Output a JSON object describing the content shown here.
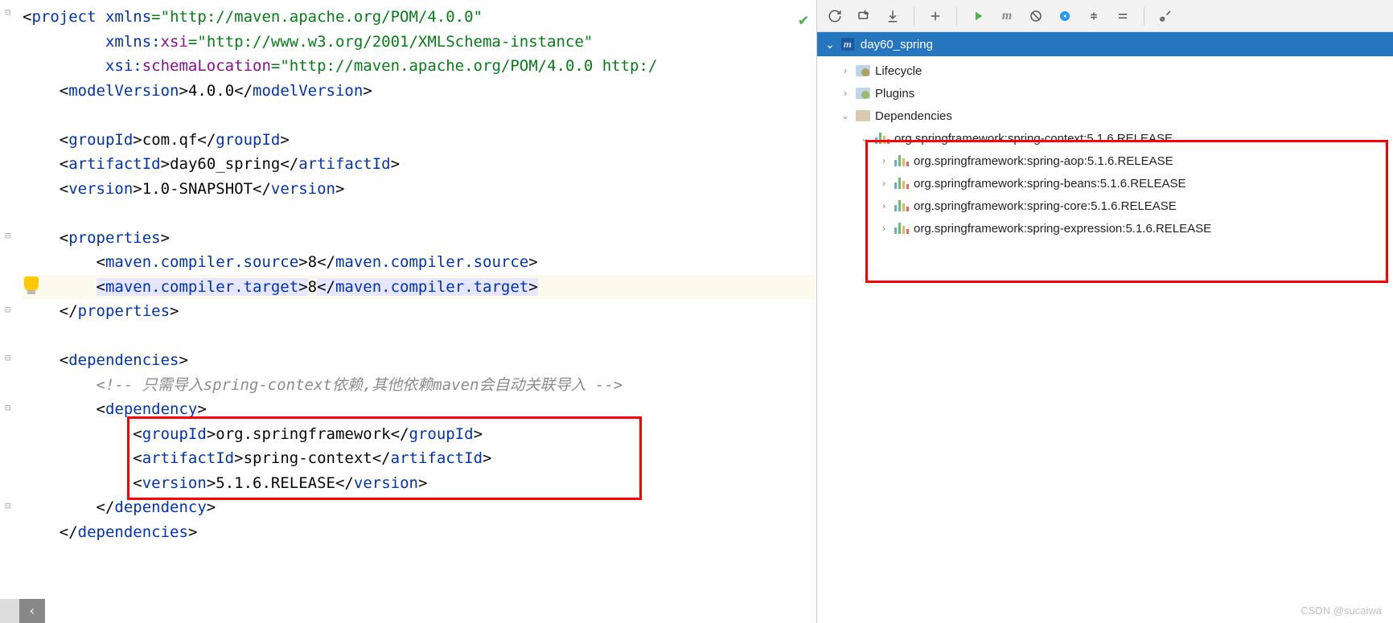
{
  "editor": {
    "lines": [
      {
        "indent": 0,
        "tokens": [
          {
            "t": "<",
            "c": "black"
          },
          {
            "t": "project ",
            "c": "blue"
          },
          {
            "t": "xmlns",
            "c": "blue"
          },
          {
            "t": "=",
            "c": "green"
          },
          {
            "t": "\"http://maven.apache.org/POM/4.0.0\"",
            "c": "green"
          }
        ]
      },
      {
        "indent": 0,
        "tokens": [
          {
            "t": "         ",
            "c": "black"
          },
          {
            "t": "xmlns:",
            "c": "blue"
          },
          {
            "t": "xsi",
            "c": "purple"
          },
          {
            "t": "=",
            "c": "green"
          },
          {
            "t": "\"http://www.w3.org/2001/XMLSchema-instance\"",
            "c": "green"
          }
        ]
      },
      {
        "indent": 0,
        "tokens": [
          {
            "t": "         ",
            "c": "black"
          },
          {
            "t": "xsi",
            "c": "blue"
          },
          {
            "t": ":",
            "c": "blue"
          },
          {
            "t": "schemaLocation",
            "c": "purple"
          },
          {
            "t": "=",
            "c": "green"
          },
          {
            "t": "\"http://maven.apache.org/POM/4.0.0 http:/",
            "c": "green"
          }
        ]
      },
      {
        "indent": 1,
        "tokens": [
          {
            "t": "<",
            "c": "black"
          },
          {
            "t": "modelVersion",
            "c": "blue"
          },
          {
            "t": ">",
            "c": "black"
          },
          {
            "t": "4.0.0",
            "c": "black"
          },
          {
            "t": "</",
            "c": "black"
          },
          {
            "t": "modelVersion",
            "c": "blue"
          },
          {
            "t": ">",
            "c": "black"
          }
        ]
      },
      {
        "indent": 0,
        "tokens": [
          {
            "t": "",
            "c": "black"
          }
        ]
      },
      {
        "indent": 1,
        "tokens": [
          {
            "t": "<",
            "c": "black"
          },
          {
            "t": "groupId",
            "c": "blue"
          },
          {
            "t": ">",
            "c": "black"
          },
          {
            "t": "com.qf",
            "c": "black"
          },
          {
            "t": "</",
            "c": "black"
          },
          {
            "t": "groupId",
            "c": "blue"
          },
          {
            "t": ">",
            "c": "black"
          }
        ]
      },
      {
        "indent": 1,
        "tokens": [
          {
            "t": "<",
            "c": "black"
          },
          {
            "t": "artifactId",
            "c": "blue"
          },
          {
            "t": ">",
            "c": "black"
          },
          {
            "t": "day60_spring",
            "c": "black"
          },
          {
            "t": "</",
            "c": "black"
          },
          {
            "t": "artifactId",
            "c": "blue"
          },
          {
            "t": ">",
            "c": "black"
          }
        ]
      },
      {
        "indent": 1,
        "tokens": [
          {
            "t": "<",
            "c": "black"
          },
          {
            "t": "version",
            "c": "blue"
          },
          {
            "t": ">",
            "c": "black"
          },
          {
            "t": "1.0-SNAPSHOT",
            "c": "black"
          },
          {
            "t": "</",
            "c": "black"
          },
          {
            "t": "version",
            "c": "blue"
          },
          {
            "t": ">",
            "c": "black"
          }
        ]
      },
      {
        "indent": 0,
        "tokens": [
          {
            "t": "",
            "c": "black"
          }
        ]
      },
      {
        "indent": 1,
        "tokens": [
          {
            "t": "<",
            "c": "black"
          },
          {
            "t": "properties",
            "c": "blue"
          },
          {
            "t": ">",
            "c": "black"
          }
        ]
      },
      {
        "indent": 2,
        "tokens": [
          {
            "t": "<",
            "c": "black"
          },
          {
            "t": "maven.compiler.source",
            "c": "blue"
          },
          {
            "t": ">",
            "c": "black"
          },
          {
            "t": "8",
            "c": "black"
          },
          {
            "t": "</",
            "c": "black"
          },
          {
            "t": "maven.compiler.source",
            "c": "blue"
          },
          {
            "t": ">",
            "c": "black"
          }
        ]
      },
      {
        "indent": 2,
        "hl": true,
        "tokens": [
          {
            "t": "<",
            "c": "black",
            "sel": true
          },
          {
            "t": "maven.compiler.target",
            "c": "blue",
            "sel": true
          },
          {
            "t": ">",
            "c": "black",
            "sel": true
          },
          {
            "t": "8",
            "c": "black"
          },
          {
            "t": "</",
            "c": "black",
            "sel": true
          },
          {
            "t": "maven.compiler.target",
            "c": "blue",
            "sel": true
          },
          {
            "t": ">",
            "c": "black",
            "sel": true
          }
        ]
      },
      {
        "indent": 1,
        "tokens": [
          {
            "t": "</",
            "c": "black"
          },
          {
            "t": "properties",
            "c": "blue"
          },
          {
            "t": ">",
            "c": "black"
          }
        ]
      },
      {
        "indent": 0,
        "tokens": [
          {
            "t": "",
            "c": "black"
          }
        ]
      },
      {
        "indent": 1,
        "tokens": [
          {
            "t": "<",
            "c": "black"
          },
          {
            "t": "dependencies",
            "c": "blue"
          },
          {
            "t": ">",
            "c": "black"
          }
        ]
      },
      {
        "indent": 2,
        "tokens": [
          {
            "t": "<!-- 只需导入spring-context依赖,其他依赖maven会自动关联导入 -->",
            "c": "gray"
          }
        ]
      },
      {
        "indent": 2,
        "tokens": [
          {
            "t": "<",
            "c": "black"
          },
          {
            "t": "dependency",
            "c": "blue"
          },
          {
            "t": ">",
            "c": "black"
          }
        ]
      },
      {
        "indent": 3,
        "tokens": [
          {
            "t": "<",
            "c": "black"
          },
          {
            "t": "groupId",
            "c": "blue"
          },
          {
            "t": ">",
            "c": "black"
          },
          {
            "t": "org.springframework",
            "c": "black"
          },
          {
            "t": "</",
            "c": "black"
          },
          {
            "t": "groupId",
            "c": "blue"
          },
          {
            "t": ">",
            "c": "black"
          }
        ]
      },
      {
        "indent": 3,
        "tokens": [
          {
            "t": "<",
            "c": "black"
          },
          {
            "t": "artifactId",
            "c": "blue"
          },
          {
            "t": ">",
            "c": "black"
          },
          {
            "t": "spring-context",
            "c": "black"
          },
          {
            "t": "</",
            "c": "black"
          },
          {
            "t": "artifactId",
            "c": "blue"
          },
          {
            "t": ">",
            "c": "black"
          }
        ]
      },
      {
        "indent": 3,
        "tokens": [
          {
            "t": "<",
            "c": "black"
          },
          {
            "t": "version",
            "c": "blue"
          },
          {
            "t": ">",
            "c": "black"
          },
          {
            "t": "5.1.6.RELEASE",
            "c": "black"
          },
          {
            "t": "</",
            "c": "black"
          },
          {
            "t": "version",
            "c": "blue"
          },
          {
            "t": ">",
            "c": "black"
          }
        ]
      },
      {
        "indent": 2,
        "tokens": [
          {
            "t": "</",
            "c": "black"
          },
          {
            "t": "dependency",
            "c": "blue"
          },
          {
            "t": ">",
            "c": "black"
          }
        ]
      },
      {
        "indent": 1,
        "tokens": [
          {
            "t": "</",
            "c": "black"
          },
          {
            "t": "dependencies",
            "c": "blue"
          },
          {
            "t": ">",
            "c": "black"
          }
        ]
      }
    ],
    "bottom_arrow": "‹"
  },
  "side": {
    "project_name": "day60_spring",
    "tree": {
      "lifecycle": "Lifecycle",
      "plugins": "Plugins",
      "dependencies": "Dependencies",
      "deps": [
        "org.springframework:spring-context:5.1.6.RELEASE",
        "org.springframework:spring-aop:5.1.6.RELEASE",
        "org.springframework:spring-beans:5.1.6.RELEASE",
        "org.springframework:spring-core:5.1.6.RELEASE",
        "org.springframework:spring-expression:5.1.6.RELEASE"
      ]
    }
  },
  "watermark": "CSDN @sucaiwa"
}
